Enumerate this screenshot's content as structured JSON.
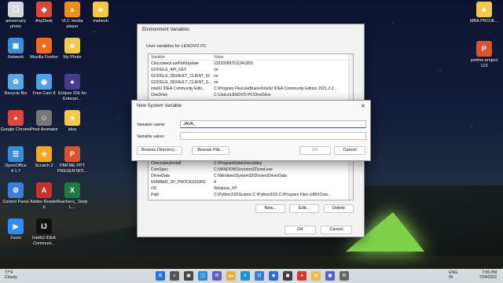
{
  "desktop": {
    "icons": [
      {
        "label": "anivernary photo",
        "glyph": "❐",
        "color": "#d8d8d8"
      },
      {
        "label": "AnyDesk",
        "glyph": "◆",
        "color": "#e0453a"
      },
      {
        "label": "VLC media player",
        "glyph": "▲",
        "color": "#f08c1a"
      },
      {
        "label": "mahesh",
        "glyph": "■",
        "color": "#f4c94a"
      },
      {
        "label": "Network",
        "glyph": "▣",
        "color": "#3d8ad6"
      },
      {
        "label": "Mozilla Firefox",
        "glyph": "●",
        "color": "#ef6b1f"
      },
      {
        "label": "My Photo",
        "glyph": "■",
        "color": "#f4c94a"
      },
      {
        "label": "Recycle Bin",
        "glyph": "♻",
        "color": "#5aa6e6"
      },
      {
        "label": "Free Cam 8",
        "glyph": "◉",
        "color": "#4aa3e8"
      },
      {
        "label": "Eclipse IDE for Enterpri...",
        "glyph": "●",
        "color": "#4a3a8c"
      },
      {
        "label": "Google Chrome",
        "glyph": "●",
        "color": "#e0453a"
      },
      {
        "label": "Pivot Animator",
        "glyph": "☺",
        "color": "#777777"
      },
      {
        "label": "idea",
        "glyph": "■",
        "color": "#f4c94a"
      },
      {
        "label": "OpenOffice 4.1.7",
        "glyph": "☰",
        "color": "#3a8ad6"
      },
      {
        "label": "Scratch 2",
        "glyph": "★",
        "color": "#f5a623"
      },
      {
        "label": "PMFME PPT PRESENTATI...",
        "glyph": "P",
        "color": "#d9532c"
      },
      {
        "label": "Control Panel",
        "glyph": "⚙",
        "color": "#3b7dd8"
      },
      {
        "label": "Adobe Reader X",
        "glyph": "A",
        "color": "#c9302c"
      },
      {
        "label": "Teachers_ Daily L...",
        "glyph": "X",
        "color": "#1d7a43"
      },
      {
        "label": "Zoom",
        "glyph": "▶",
        "color": "#2d8cff"
      },
      {
        "label": "IntelliJ IDEA Communi...",
        "glyph": "IJ",
        "color": "#111111"
      },
      {
        "label": "MBA PROJE...",
        "glyph": "■",
        "color": "#f4c94a"
      },
      {
        "label": "pmfme project 123",
        "glyph": "P",
        "color": "#d9532c"
      }
    ]
  },
  "env_window": {
    "title": "Environment Variables",
    "user_vars_label": "User variables for LENOVO PC",
    "columns": [
      "Variable",
      "Value"
    ],
    "user_rows": [
      [
        "ChocolateyLastPathUpdate",
        "132932897511941853"
      ],
      [
        "GOOGLE_API_KEY",
        "no"
      ],
      [
        "GOOGLE_DEFAULT_CLIENT_ID",
        "no"
      ],
      [
        "GOOGLE_DEFAULT_CLIENT_S...",
        "no"
      ],
      [
        "IntelliJ IDEA Community Editi...",
        "C:\\Program Files\\JetBrains\\IntelliJ IDEA Community Edition 2021.2.3..."
      ],
      [
        "OneDrive",
        "C:\\Users\\LENOVO PC\\OneDrive"
      ]
    ],
    "system_rows": [
      [
        "ChocolateyInstall",
        "C:\\ProgramData\\chocolatey"
      ],
      [
        "ComSpec",
        "C:\\WINDOWS\\system32\\cmd.exe"
      ],
      [
        "DriverData",
        "C:\\Windows\\System32\\Drivers\\DriverData"
      ],
      [
        "NUMBER_OF_PROCESSORS",
        "4"
      ],
      [
        "OS",
        "Windows_NT"
      ],
      [
        "Path",
        "C:\\Python310\\Scripts\\;C:\\Python310\\;C:\\Program Files (x86)\\Com..."
      ]
    ],
    "new_label": "New...",
    "edit_label": "Edit...",
    "delete_label": "Delete",
    "ok_label": "OK",
    "cancel_label": "Cancel"
  },
  "dialog": {
    "title": "New System Variable",
    "close": "✕",
    "name_label": "Variable name:",
    "name_value": "JAVA_",
    "value_label": "Variable value:",
    "value_value": "",
    "browse_dir": "Browse Directory...",
    "browse_file": "Browse File...",
    "ok": "OK",
    "cancel": "Cancel"
  },
  "taskbar": {
    "weather_temp": "77°F",
    "weather_desc": "Cloudy",
    "lang1": "ENG",
    "lang2": "IN",
    "time": "7:05 PM",
    "date": "7/24/2022"
  }
}
